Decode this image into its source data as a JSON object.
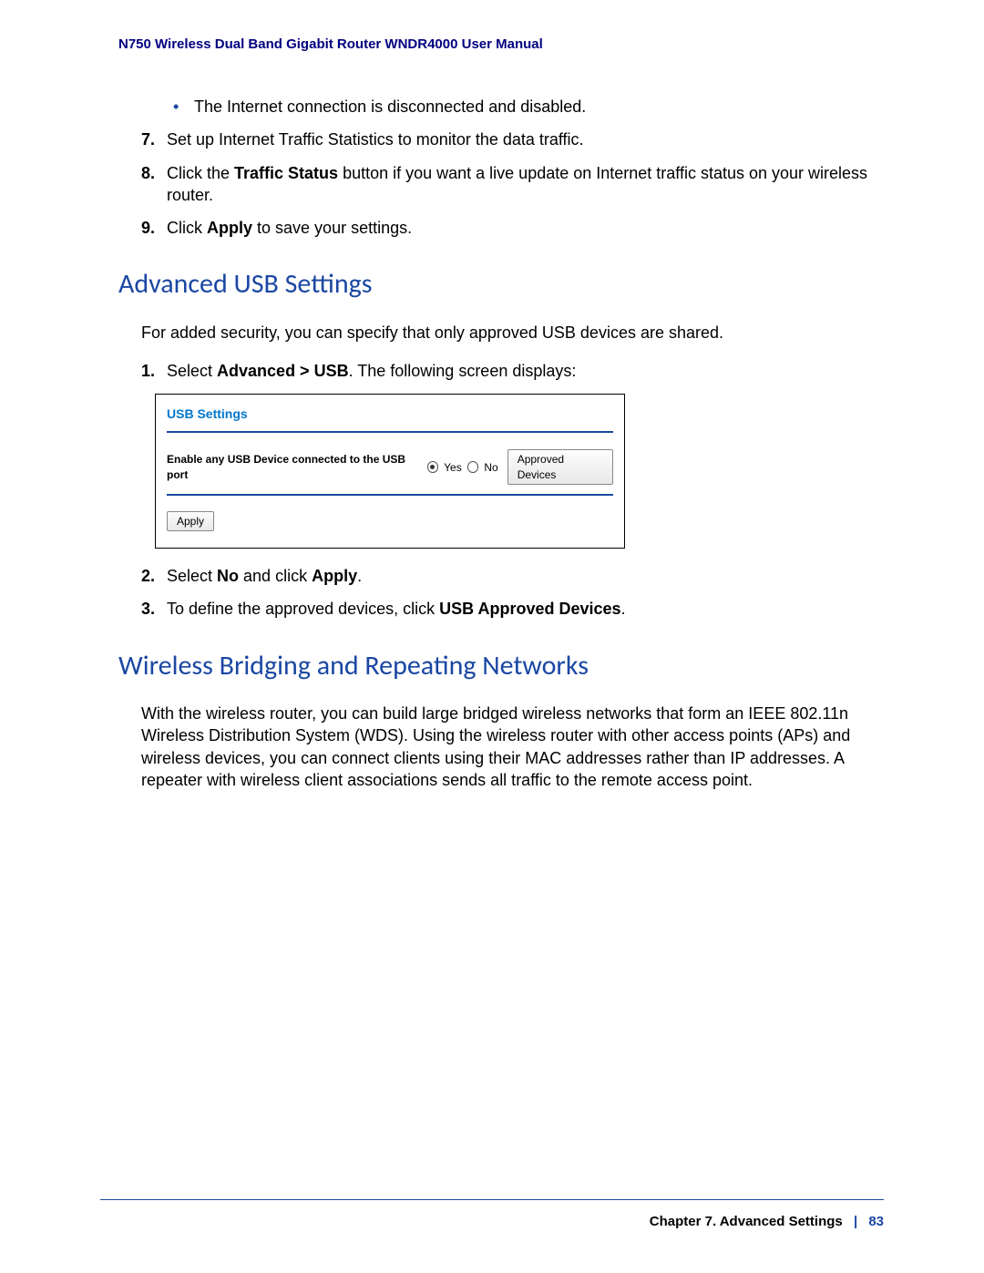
{
  "header": "N750 Wireless Dual Band Gigabit Router WNDR4000 User Manual",
  "bullet_line": "The Internet connection is disconnected and disabled.",
  "item7": {
    "num": "7.",
    "text": "Set up Internet Traffic Statistics to monitor the data traffic."
  },
  "item8": {
    "num": "8.",
    "pre": "Click the ",
    "bold": "Traffic Status",
    "post": " button if you want a live update on Internet traffic status on your wireless router."
  },
  "item9": {
    "num": "9.",
    "pre": "Click ",
    "bold": "Apply",
    "post": " to save your settings."
  },
  "section1_title": "Advanced USB Settings",
  "section1_para": "For added security, you can specify that only approved USB devices are shared.",
  "s1_step1": {
    "num": "1.",
    "pre": "Select ",
    "bold": "Advanced > USB",
    "post": ". The following screen displays:"
  },
  "usb_box": {
    "title": "USB Settings",
    "label": "Enable any USB Device connected to the USB port",
    "yes": "Yes",
    "no": "No",
    "approved_btn": "Approved Devices",
    "apply_btn": "Apply"
  },
  "s1_step2": {
    "num": "2.",
    "pre": "Select ",
    "bold1": "No",
    "mid": " and click ",
    "bold2": "Apply",
    "post": "."
  },
  "s1_step3": {
    "num": "3.",
    "pre": "To define the approved devices, click ",
    "bold": "USB Approved Devices",
    "post": "."
  },
  "section2_title": "Wireless Bridging and Repeating Networks",
  "section2_para": "With the wireless router, you can build large bridged wireless networks that form an IEEE 802.11n Wireless Distribution System (WDS). Using the wireless router with other access points (APs) and wireless devices, you can connect clients using their MAC addresses rather than IP addresses. A repeater with wireless client associations sends all traffic to the remote access point.",
  "footer": {
    "chapter": "Chapter 7.  Advanced Settings",
    "sep": "|",
    "page": "83"
  }
}
